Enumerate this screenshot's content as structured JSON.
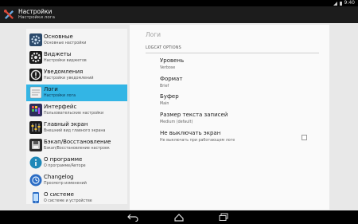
{
  "status": {
    "time": "9:40"
  },
  "app": {
    "title": "Настройки",
    "subtitle": "Настройки лога",
    "icon": "tools-icon"
  },
  "sidebar": {
    "items": [
      {
        "title": "Основные",
        "subtitle": "Основные настройки",
        "icon": "gear-icon",
        "color": "#2c4a6b",
        "active": false
      },
      {
        "title": "Виджеты",
        "subtitle": "Настройки виджетов",
        "icon": "widget-gear-icon",
        "color": "#1b1b1b",
        "active": false
      },
      {
        "title": "Уведомления",
        "subtitle": "Настройки уведомлений",
        "icon": "notification-icon",
        "color": "#1b1b1b",
        "active": false
      },
      {
        "title": "Логи",
        "subtitle": "Настройки лога",
        "icon": "notepad-icon",
        "color": "#e8e8e8",
        "active": true
      },
      {
        "title": "Интерфейс",
        "subtitle": "Пользовательские настройки",
        "icon": "palette-icon",
        "color": "#3a3a7a",
        "active": false
      },
      {
        "title": "Главный экран",
        "subtitle": "Внешний вид главного экрана",
        "icon": "equalizer-icon",
        "color": "#1b1b1b",
        "active": false
      },
      {
        "title": "Бэкап/Восстановление",
        "subtitle": "Бэкап/Восстановление настроек",
        "icon": "backup-icon",
        "color": "#2a2a2a",
        "active": false
      },
      {
        "title": "О программе",
        "subtitle": "О программе/Авторе",
        "icon": "info-icon",
        "color": "#1e88b8",
        "active": false
      },
      {
        "title": "Changelog",
        "subtitle": "Просмотр изменений",
        "icon": "changelog-icon",
        "color": "#2b6cc4",
        "active": false
      },
      {
        "title": "О системе",
        "subtitle": "О системе и устройстве",
        "icon": "phone-icon",
        "color": "#2b6cc4",
        "active": false
      }
    ]
  },
  "main": {
    "header": "Логи",
    "section": "LOGCAT OPTIONS",
    "prefs": [
      {
        "title": "Уровень",
        "subtitle": "Verbose"
      },
      {
        "title": "Формат",
        "subtitle": "Brief"
      },
      {
        "title": "Буфер",
        "subtitle": "Main"
      },
      {
        "title": "Размер текста записей",
        "subtitle": "Medium (default)"
      },
      {
        "title": "Не выключать экран",
        "subtitle": "Не выключать при работающем логе",
        "checkbox": true,
        "checked": false
      }
    ]
  },
  "navbar": {
    "buttons": [
      "back-icon",
      "home-icon",
      "recents-icon"
    ]
  }
}
